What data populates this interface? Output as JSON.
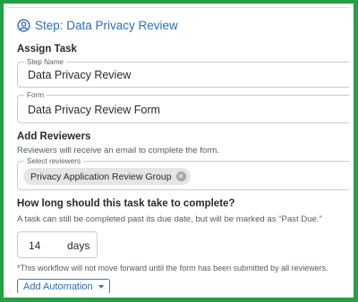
{
  "colors": {
    "accent": "#2f6db5",
    "frame": "#22a244",
    "chip": "#e3e5e8"
  },
  "step": {
    "icon": "user-circle-icon",
    "title": "Step: Data Privacy Review"
  },
  "assign_task": {
    "heading": "Assign Task",
    "step_name": {
      "legend": "Step Name",
      "value": "Data Privacy Review"
    },
    "form": {
      "legend": "Form",
      "value": "Data Privacy Review Form"
    }
  },
  "reviewers": {
    "heading": "Add Reviewers",
    "helper": "Reviewers will receive an email to complete the form.",
    "select": {
      "legend": "Select reviewers",
      "chips": [
        {
          "label": "Privacy Application Review Group",
          "remove_icon": "close-circle-icon"
        }
      ]
    }
  },
  "duration": {
    "heading": "How long should this task take to complete?",
    "helper": "A task can still be completed past its due date, but will be marked as “Past Due.”",
    "value": "14",
    "unit": "days"
  },
  "footnote": "*This workflow will not move forward until the form has been submitted by all reviewers.",
  "add_automation": {
    "label": "Add Automation",
    "icon": "caret-down-icon"
  }
}
